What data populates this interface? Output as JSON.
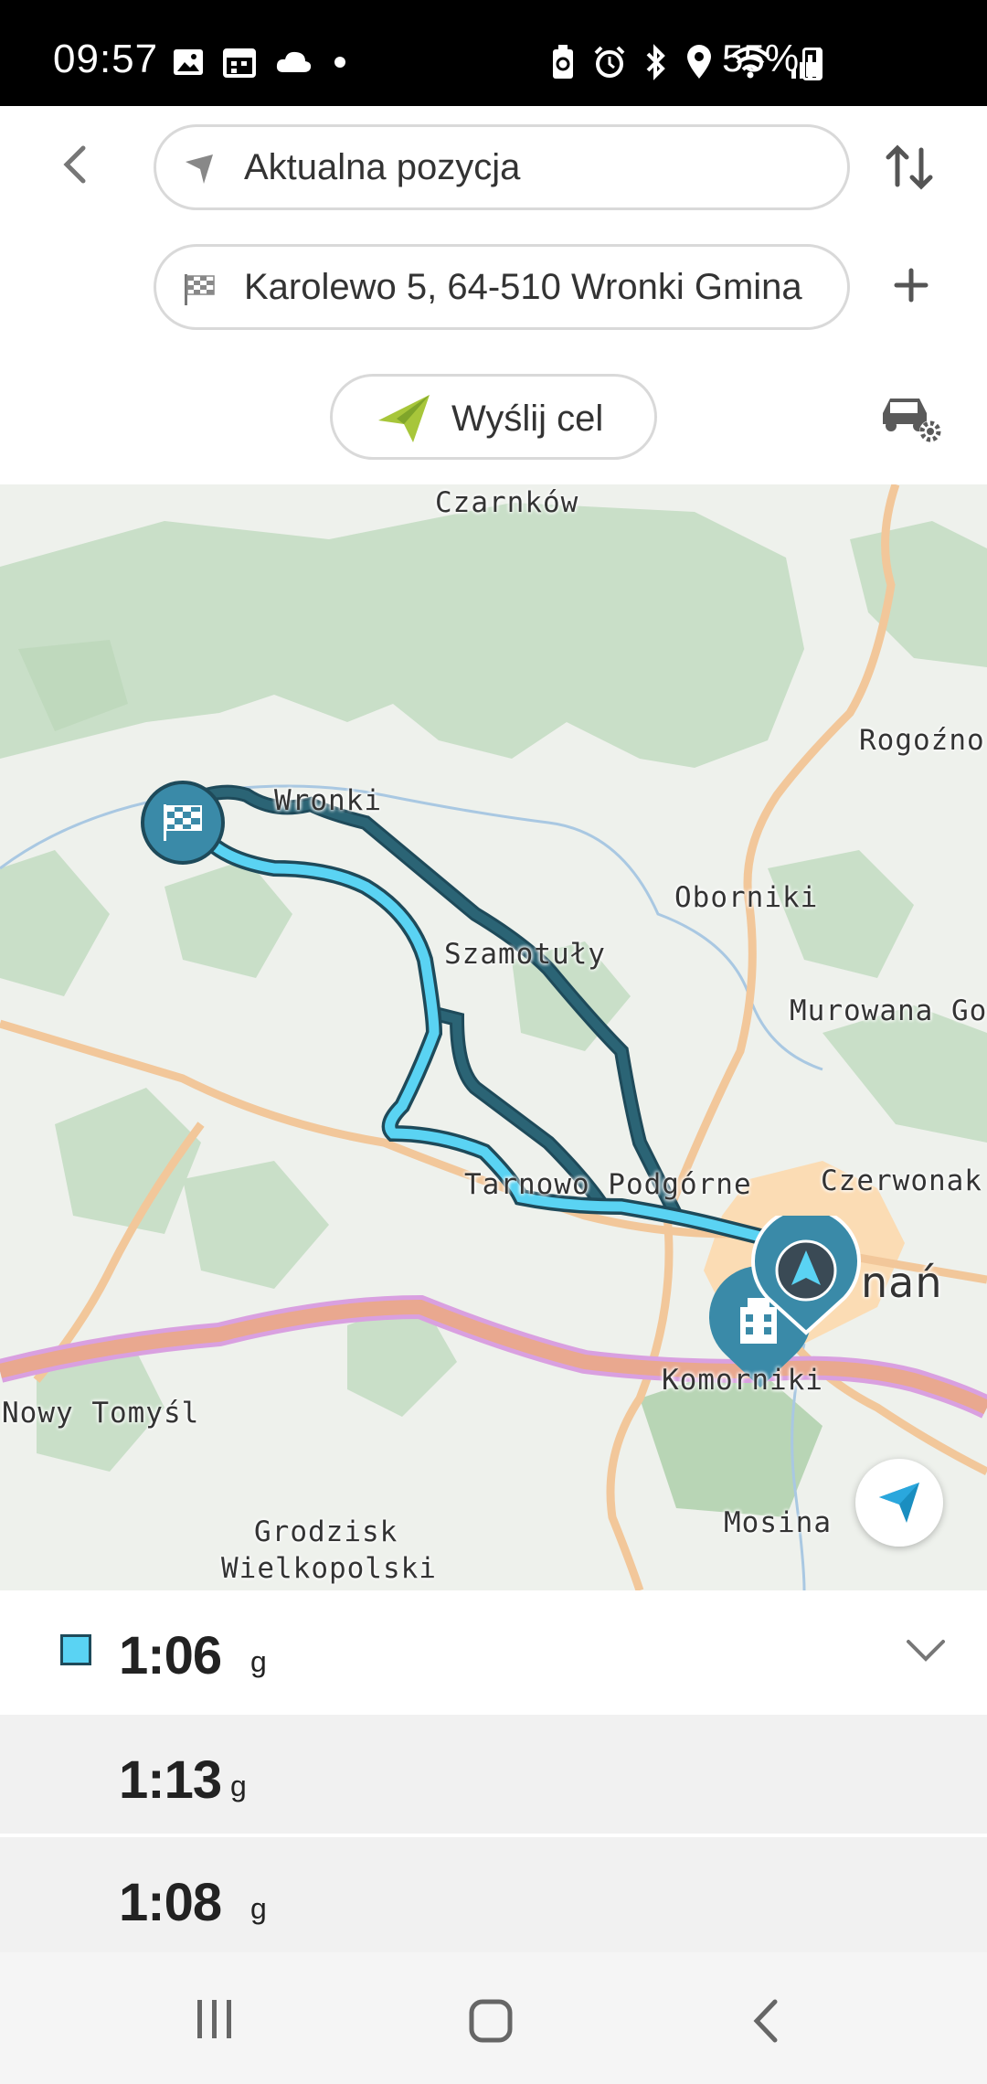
{
  "status_bar": {
    "time": "09:57",
    "battery": "55%",
    "left_icons": [
      "image-icon",
      "calendar-icon",
      "cloud-icon",
      "dot-icon"
    ],
    "right_icons": [
      "recycle-battery-icon",
      "alarm-icon",
      "bluetooth-icon",
      "location-icon",
      "wifi-icon",
      "signal-icon"
    ]
  },
  "route_form": {
    "origin": "Aktualna pozycja",
    "destination": "Karolewo 5, 64-510 Wronki Gmina",
    "send_label": "Wyślij cel"
  },
  "map": {
    "labels": {
      "czarnkow": "Czarnków",
      "rogozno": "Rogoźno",
      "wronki": "Wronki",
      "oborniki": "Oborniki",
      "szamotuly": "Szamotuły",
      "murowana": "Murowana Go",
      "tarnowo": "Tarnowo Podgórne",
      "czerwonak": "Czerwonak",
      "poznan": "nań",
      "komorniki": "Komorniki",
      "nowy_tomysl": "Nowy Tomyśl",
      "mosina": "Mosina",
      "grodzisk_1": "Grodzisk",
      "grodzisk_2": "Wielkopolski"
    },
    "colors": {
      "forest": "#c9dfc8",
      "route_primary": "#5ad3f3",
      "route_alt": "#2b6475",
      "road": "#f2c79a",
      "motorway": "#e9a88f",
      "urban": "#fbdcb4"
    }
  },
  "routes": [
    {
      "time": "1:06",
      "unit": "g",
      "selected": true
    },
    {
      "time": "1:13",
      "unit": "g",
      "selected": false
    },
    {
      "time": "1:08",
      "unit": "g",
      "selected": false
    }
  ]
}
